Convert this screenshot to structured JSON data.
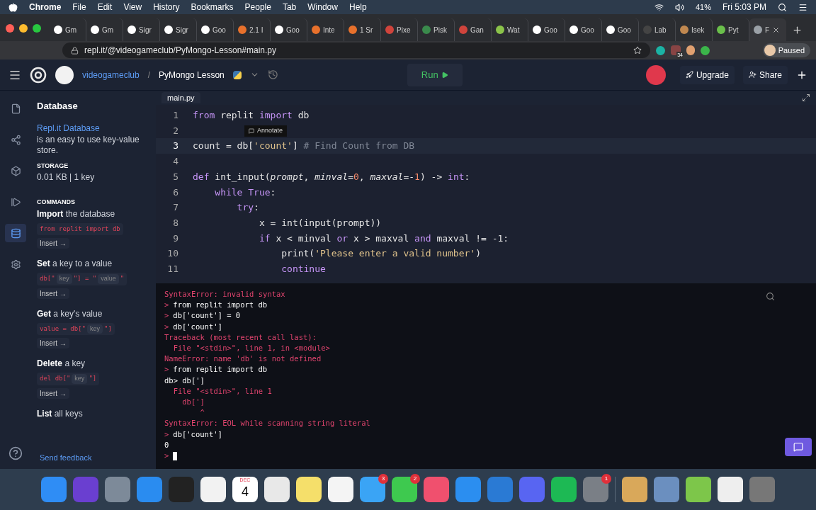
{
  "menu_bar": {
    "app": "Chrome",
    "menus": [
      "File",
      "Edit",
      "View",
      "History",
      "Bookmarks",
      "People",
      "Tab",
      "Window",
      "Help"
    ],
    "battery": "41%",
    "clock": "Fri 5:03 PM"
  },
  "browser_tabs": [
    {
      "label": "Gm",
      "selected": false,
      "color": "#ffffff"
    },
    {
      "label": "Gm",
      "selected": false,
      "color": "#ffffff"
    },
    {
      "label": "Sigr",
      "selected": false,
      "color": "#ffffff"
    },
    {
      "label": "Sigr",
      "selected": false,
      "color": "#ffffff"
    },
    {
      "label": "Goo",
      "selected": false,
      "color": "#ffffff"
    },
    {
      "label": "2.1 I",
      "selected": false,
      "color": "#e8712c"
    },
    {
      "label": "Goo",
      "selected": false,
      "color": "#ffffff"
    },
    {
      "label": "Inte",
      "selected": false,
      "color": "#e8712c"
    },
    {
      "label": "1 Sr",
      "selected": false,
      "color": "#e8712c"
    },
    {
      "label": "Pixe",
      "selected": false,
      "color": "#d0443c"
    },
    {
      "label": "Pisk",
      "selected": false,
      "color": "#3a8a4c"
    },
    {
      "label": "Gan",
      "selected": false,
      "color": "#d0443c"
    },
    {
      "label": "Wat",
      "selected": false,
      "color": "#8bc34a"
    },
    {
      "label": "Goo",
      "selected": false,
      "color": "#ffffff"
    },
    {
      "label": "Goo",
      "selected": false,
      "color": "#ffffff"
    },
    {
      "label": "Goo",
      "selected": false,
      "color": "#ffffff"
    },
    {
      "label": "Lab",
      "selected": false,
      "color": "#444444"
    },
    {
      "label": "Isek",
      "selected": false,
      "color": "#c08850"
    },
    {
      "label": "Pyt",
      "selected": false,
      "color": "#6abf4b"
    },
    {
      "label": "F",
      "selected": true,
      "color": "#9aa0a6"
    }
  ],
  "address_bar": {
    "url": "repl.it/@videogameclub/PyMongo-Lesson#main.py",
    "extension_badge": "34",
    "profile": "Paused"
  },
  "repl_header": {
    "owner": "videogameclub",
    "separator": "/",
    "name": "PyMongo Lesson",
    "run": "Run",
    "upgrade": "Upgrade",
    "share": "Share"
  },
  "rail": [
    {
      "kind": "file",
      "selected": false
    },
    {
      "kind": "share",
      "selected": false
    },
    {
      "kind": "cube",
      "selected": false
    },
    {
      "kind": "play",
      "selected": false
    },
    {
      "kind": "database",
      "selected": true
    },
    {
      "kind": "settings",
      "selected": false
    }
  ],
  "panel": {
    "title": "Database",
    "link": "Repl.it Database",
    "description": "is an easy to use key-value store.",
    "storage_label": "STORAGE",
    "storage_value": "0.01 KB | 1 key",
    "commands_label": "COMMANDS",
    "commands": [
      {
        "verb": "Import",
        "rest": "the database",
        "code": [
          {
            "kind": "code",
            "text": "from replit import db"
          }
        ],
        "insert": "Insert →"
      },
      {
        "verb": "Set",
        "rest": "a key to a value",
        "code": [
          {
            "kind": "code",
            "text": "db[\""
          },
          {
            "kind": "slot",
            "text": "key"
          },
          {
            "kind": "code",
            "text": "\"] = \""
          },
          {
            "kind": "slot",
            "text": "value"
          },
          {
            "kind": "code",
            "text": "\""
          }
        ],
        "insert": "Insert →"
      },
      {
        "verb": "Get",
        "rest": "a key's value",
        "code": [
          {
            "kind": "code",
            "text": "value = db[\""
          },
          {
            "kind": "slot",
            "text": "key"
          },
          {
            "kind": "code",
            "text": "\"]"
          }
        ],
        "insert": "Insert →"
      },
      {
        "verb": "Delete",
        "rest": "a key",
        "code": [
          {
            "kind": "code",
            "text": "del db[\""
          },
          {
            "kind": "slot",
            "text": "key"
          },
          {
            "kind": "code",
            "text": "\"]"
          }
        ],
        "insert": "Insert →"
      },
      {
        "verb": "List",
        "rest": "all keys"
      }
    ],
    "feedback": "Send feedback"
  },
  "editor": {
    "file_tab": "main.py",
    "tooltip": "Annotate",
    "lines": [
      {
        "number": "1",
        "current": false,
        "tokens": [
          {
            "kind": "kw",
            "text": "from"
          },
          {
            "kind": "plain",
            "text": " replit "
          },
          {
            "kind": "kw",
            "text": "import"
          },
          {
            "kind": "plain",
            "text": " db"
          }
        ]
      },
      {
        "number": "2",
        "current": false
      },
      {
        "number": "3",
        "current": true,
        "tokens": [
          {
            "kind": "plain",
            "text": "count = db["
          },
          {
            "kind": "str",
            "text": "'count'"
          },
          {
            "kind": "plain",
            "text": "] "
          },
          {
            "kind": "comment",
            "text": "# Find Count from DB"
          }
        ]
      },
      {
        "number": "4",
        "current": false
      },
      {
        "number": "5",
        "current": false,
        "tokens": [
          {
            "kind": "kw",
            "text": "def"
          },
          {
            "kind": "plain",
            "text": " int_input("
          },
          {
            "kind": "param",
            "text": "prompt"
          },
          {
            "kind": "plain",
            "text": ", "
          },
          {
            "kind": "param",
            "text": "minval"
          },
          {
            "kind": "plain",
            "text": "="
          },
          {
            "kind": "num",
            "text": "0"
          },
          {
            "kind": "plain",
            "text": ", "
          },
          {
            "kind": "param",
            "text": "maxval"
          },
          {
            "kind": "plain",
            "text": "=-"
          },
          {
            "kind": "num",
            "text": "1"
          },
          {
            "kind": "plain",
            "text": ") -> "
          },
          {
            "kind": "kw",
            "text": "int"
          },
          {
            "kind": "plain",
            "text": ":"
          }
        ]
      },
      {
        "number": "6",
        "current": false,
        "tokens": [
          {
            "kind": "kw",
            "text": "    while"
          },
          {
            "kind": "kw",
            "text": " True"
          },
          {
            "kind": "plain",
            "text": ":"
          }
        ]
      },
      {
        "number": "7",
        "current": false,
        "tokens": [
          {
            "kind": "kw",
            "text": "        try"
          },
          {
            "kind": "plain",
            "text": ":"
          }
        ]
      },
      {
        "number": "8",
        "current": false,
        "tokens": [
          {
            "kind": "plain",
            "text": "            x = int(input(prompt))"
          }
        ]
      },
      {
        "number": "9",
        "current": false,
        "tokens": [
          {
            "kind": "kw",
            "text": "            if"
          },
          {
            "kind": "plain",
            "text": " x < minval "
          },
          {
            "kind": "kw",
            "text": "or"
          },
          {
            "kind": "plain",
            "text": " x > maxval "
          },
          {
            "kind": "kw",
            "text": "and"
          },
          {
            "kind": "plain",
            "text": " maxval != -1:"
          }
        ]
      },
      {
        "number": "10",
        "current": false,
        "tokens": [
          {
            "kind": "plain",
            "text": "                print("
          },
          {
            "kind": "str",
            "text": "'Please enter a valid number'"
          },
          {
            "kind": "plain",
            "text": ")"
          }
        ]
      },
      {
        "number": "11",
        "current": false,
        "tokens": [
          {
            "kind": "kw",
            "text": "                continue"
          }
        ]
      }
    ]
  },
  "console": [
    {
      "kind": "error",
      "text": "SyntaxError: invalid syntax"
    },
    {
      "kind": "input",
      "prompt": ">",
      "text": "from replit import db"
    },
    {
      "kind": "input",
      "prompt": ">",
      "text": "db['count'] = 0"
    },
    {
      "kind": "input",
      "prompt": ">",
      "text": "db['count']"
    },
    {
      "kind": "error",
      "text": "Traceback (most recent call last):"
    },
    {
      "kind": "error",
      "text": "  File \"<stdin>\", line 1, in <module>"
    },
    {
      "kind": "error",
      "text": "NameError: name 'db' is not defined"
    },
    {
      "kind": "input",
      "prompt": ">",
      "text": "from replit import db"
    },
    {
      "kind": "output",
      "text": "db> db[']"
    },
    {
      "kind": "error",
      "text": "  File \"<stdin>\", line 1"
    },
    {
      "kind": "error",
      "text": "    db[']"
    },
    {
      "kind": "error",
      "text": "        ^"
    },
    {
      "kind": "error",
      "text": "SyntaxError: EOL while scanning string literal"
    },
    {
      "kind": "input",
      "prompt": ">",
      "text": "db['count']"
    },
    {
      "kind": "output",
      "text": "0"
    },
    {
      "kind": "cursor",
      "prompt": ">"
    }
  ],
  "dock": {
    "apps": [
      {
        "kind": "app",
        "color": "#2f8df5"
      },
      {
        "kind": "app",
        "color": "#6a3fd0"
      },
      {
        "kind": "app",
        "color": "#7d8a99"
      },
      {
        "kind": "app",
        "color": "#2a8cf0"
      },
      {
        "kind": "app",
        "color": "#222222"
      },
      {
        "kind": "app",
        "color": "#f2f2f2"
      },
      {
        "kind": "calendar",
        "color": "#ffffff",
        "month": "DEC",
        "day": "4"
      },
      {
        "kind": "app",
        "color": "#e8e8e8"
      },
      {
        "kind": "app",
        "color": "#f5df6a"
      },
      {
        "kind": "app",
        "color": "#f4f4f4"
      },
      {
        "kind": "app",
        "color": "#3aa4f5",
        "badge": "3"
      },
      {
        "kind": "app",
        "color": "#3ec94f",
        "badge": "2"
      },
      {
        "kind": "app",
        "color": "#f0506e"
      },
      {
        "kind": "app",
        "color": "#2b8ef0"
      },
      {
        "kind": "app",
        "color": "#2a7ad4"
      },
      {
        "kind": "app",
        "color": "#5865f2"
      },
      {
        "kind": "app",
        "color": "#1db954"
      },
      {
        "kind": "app",
        "color": "#7a7f86",
        "badge": "1"
      }
    ],
    "documents": [
      {
        "color": "#d9a85a"
      },
      {
        "color": "#6b8fbf"
      },
      {
        "color": "#7dc64a"
      },
      {
        "color": "#eeeeee"
      },
      {
        "color": "#777777"
      }
    ]
  }
}
